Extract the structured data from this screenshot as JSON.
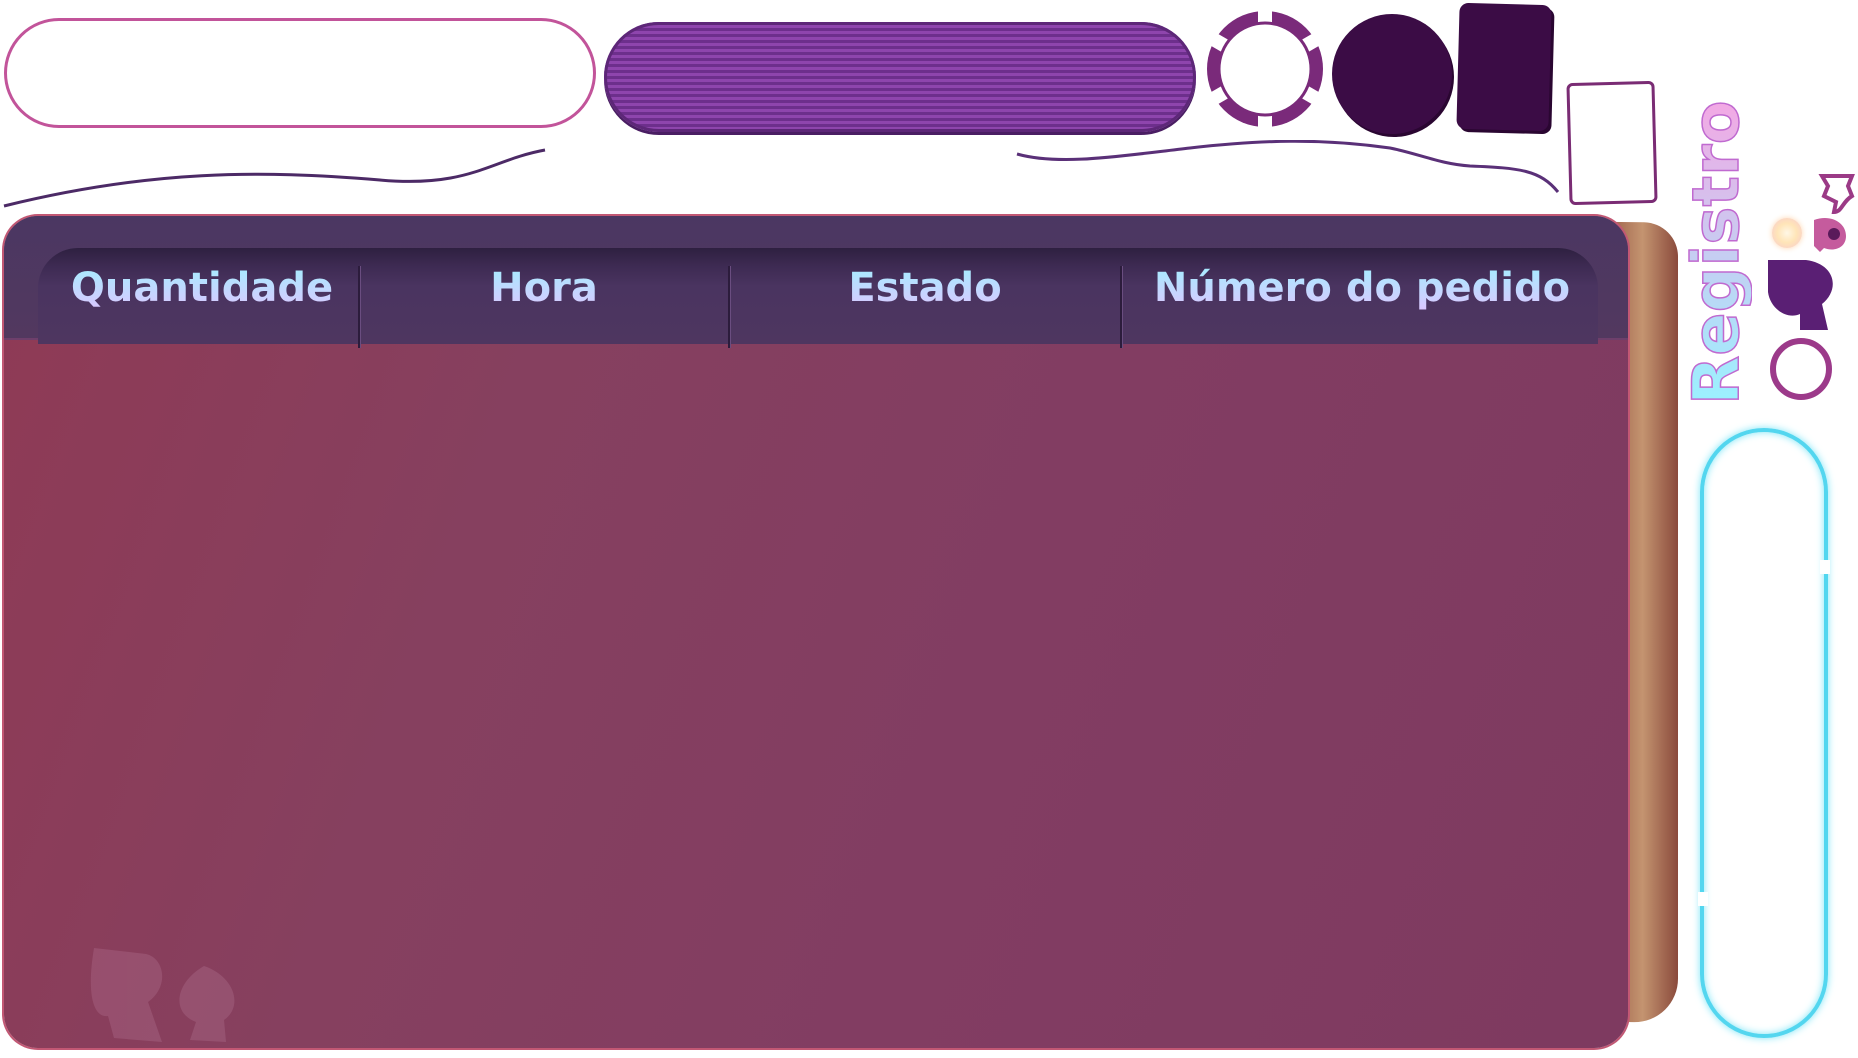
{
  "title": "Registro",
  "table": {
    "columns": [
      {
        "label": "Quantidade"
      },
      {
        "label": "Hora"
      },
      {
        "label": "Estado"
      },
      {
        "label": "Número do pedido"
      }
    ]
  },
  "colors": {
    "panel": "#86405f",
    "header": "#4e3660",
    "header_text_top": "#9cf4ff",
    "header_text_bottom": "#e4bfff",
    "accent_cyan": "#53d6ef",
    "dark_purple": "#3b0c45",
    "pill_border": "#c2549a"
  },
  "icons": [
    "poker-chip-icon",
    "spade-icon",
    "spade-small-icon",
    "ring-icon"
  ]
}
